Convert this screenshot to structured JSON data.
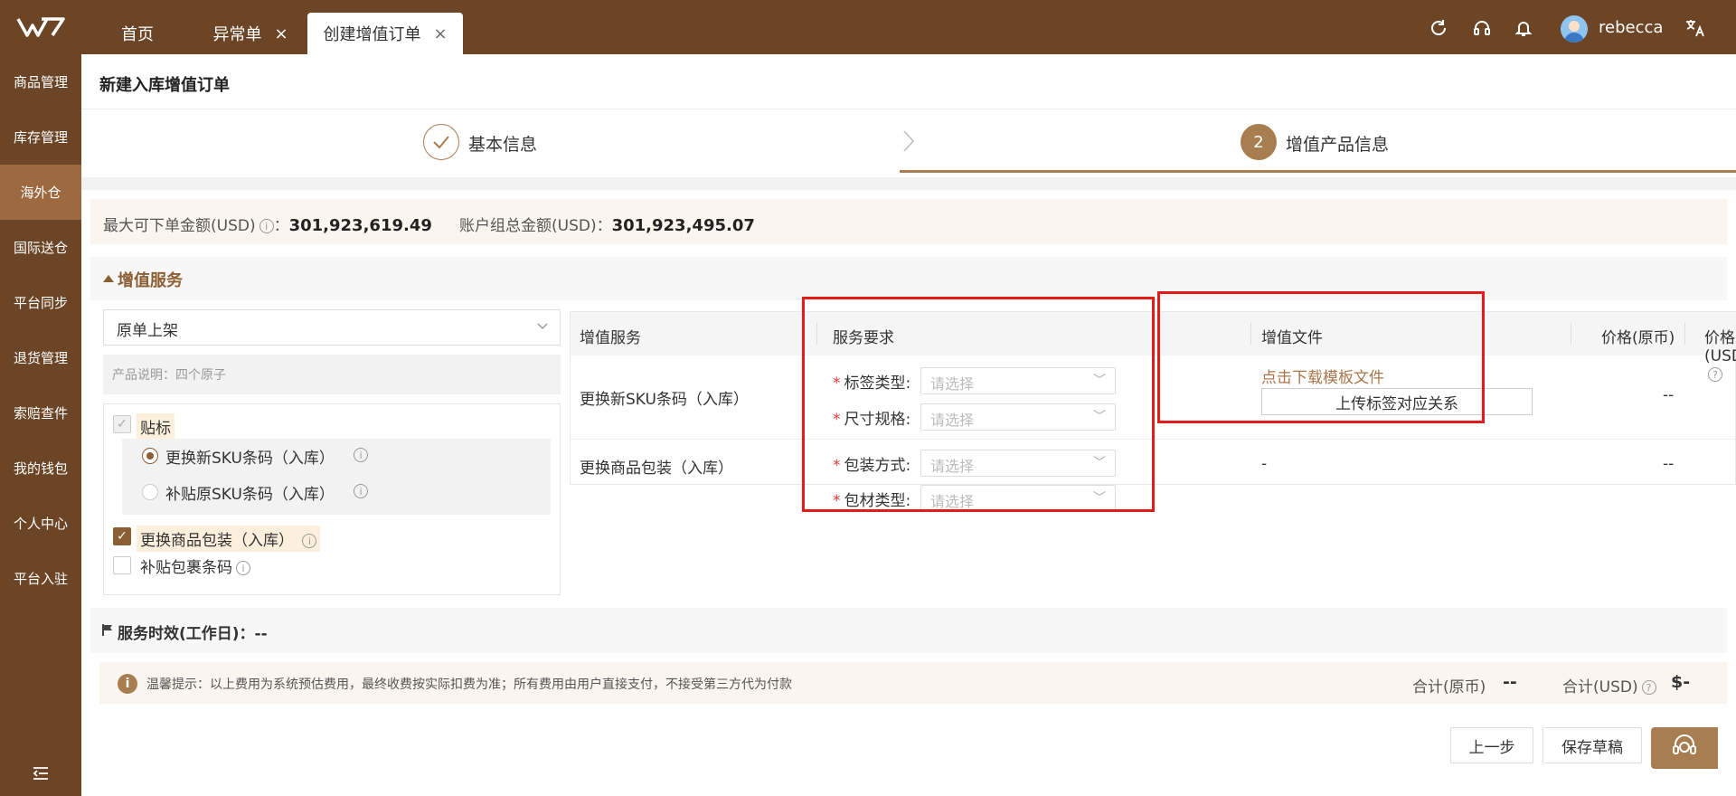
{
  "topbar": {
    "tabs": [
      {
        "label": "首页",
        "closable": false,
        "active": false
      },
      {
        "label": "异常单",
        "closable": true,
        "active": false
      },
      {
        "label": "创建增值订单",
        "closable": true,
        "active": true
      }
    ],
    "close_glyph": "×",
    "icons": [
      "refresh-icon",
      "headset-icon",
      "bell-icon",
      "translate-icon"
    ],
    "username": "rebecca"
  },
  "sidebar": {
    "items": [
      {
        "label": "商品管理"
      },
      {
        "label": "库存管理"
      },
      {
        "label": "海外仓",
        "active": true
      },
      {
        "label": "国际送仓"
      },
      {
        "label": "平台同步"
      },
      {
        "label": "退货管理"
      },
      {
        "label": "索赔查件"
      },
      {
        "label": "我的钱包"
      },
      {
        "label": "个人中心"
      },
      {
        "label": "平台入驻"
      }
    ]
  },
  "page": {
    "title": "新建入库增值订单"
  },
  "steps": [
    {
      "index": "1",
      "label": "基本信息",
      "state": "done"
    },
    {
      "index": "2",
      "label": "增值产品信息",
      "state": "active"
    }
  ],
  "balance": {
    "max_label": "最大可下单金额(USD)",
    "max_value": "301,923,619.49",
    "total_label": "账户组总金额(USD)",
    "total_value": "301,923,495.07",
    "colon": "："
  },
  "section": {
    "title": "增值服务"
  },
  "left_panel": {
    "select_value": "原单上架",
    "description": "产品说明：四个原子",
    "options": {
      "group_label": "贴标",
      "radio_1": "更换新SKU条码（入库）",
      "radio_2": "补贴原SKU条码（入库）",
      "check_2": "更换商品包装（入库）",
      "check_3": "补贴包裹条码"
    }
  },
  "table": {
    "headers": {
      "service": "增值服务",
      "requirement": "服务要求",
      "file": "增值文件",
      "price_orig": "价格(原币)",
      "price_usd": "价格(USD)"
    },
    "rows": [
      {
        "service": "更换新SKU条码（入库）",
        "fields": [
          {
            "label": "标签类型:",
            "placeholder": "请选择"
          },
          {
            "label": "尺寸规格:",
            "placeholder": "请选择"
          }
        ],
        "file_link": "点击下载模板文件",
        "file_button": "上传标签对应关系",
        "price_orig": "--",
        "price_usd": "$-"
      },
      {
        "service": "更换商品包装（入库）",
        "fields": [
          {
            "label": "包装方式:",
            "placeholder": "请选择"
          },
          {
            "label": "包材类型:",
            "placeholder": "请选择"
          }
        ],
        "file_text": "-",
        "price_orig": "--",
        "price_usd": "$-"
      }
    ],
    "required_mark": "*"
  },
  "timeline": {
    "label": "服务时效(工作日)：--"
  },
  "tip": {
    "icon": "i",
    "text": "温馨提示：以上费用为系统预估费用，最终收费按实际扣费为准；所有费用由用户直接支付，不接受第三方代为付款",
    "total_orig_label": "合计(原币)",
    "total_orig_value": "--",
    "total_usd_label": "合计(USD)",
    "total_usd_value": "$-"
  },
  "footer": {
    "prev_button": "上一步",
    "draft_button": "保存草稿"
  },
  "colors": {
    "brand": "#6b4525",
    "accent": "#a87d50",
    "highlight": "#e31b1b"
  }
}
